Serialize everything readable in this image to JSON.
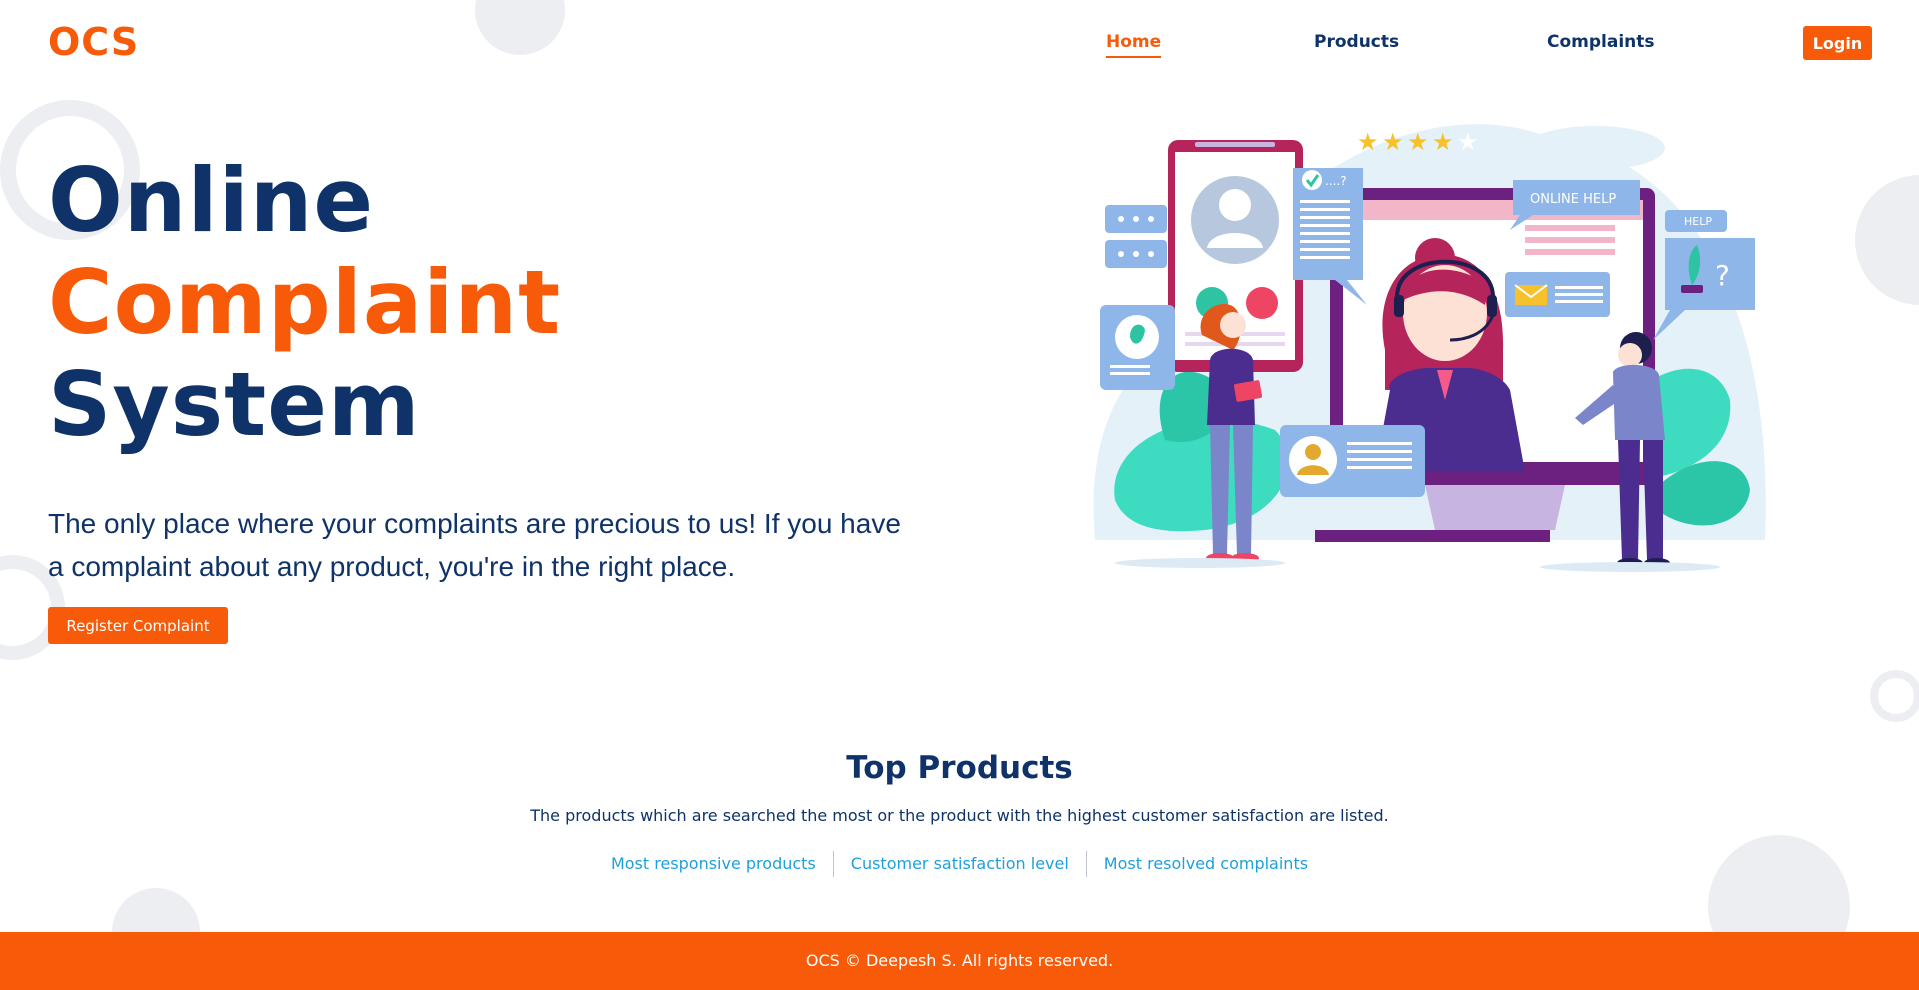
{
  "brand": {
    "logo": "OCS",
    "accent_color": "#f75a08",
    "navy_color": "#0f3369",
    "link_color": "#1ea0dc"
  },
  "nav": {
    "items": [
      {
        "label": "Home",
        "active": true
      },
      {
        "label": "Products",
        "active": false
      },
      {
        "label": "Complaints",
        "active": false
      }
    ],
    "login_label": "Login"
  },
  "hero": {
    "title_line1": "Online",
    "title_word_orange": "Complaint",
    "title_word_navy": "System",
    "description": "The only place where your complaints are precious to us! If you have a complaint about any product, you're in the right place.",
    "cta_label": "Register Complaint"
  },
  "illustration": {
    "online_help_label": "ONLINE HELP",
    "help_label": "HELP",
    "bubble_text": "....?",
    "rating_stars": 5,
    "filled_stars": 4
  },
  "products": {
    "heading": "Top Products",
    "subtitle": "The products which are searched the most or the product with the highest customer satisfaction are listed.",
    "tabs": [
      "Most responsive products",
      "Customer satisfaction level",
      "Most resolved complaints"
    ]
  },
  "footer": {
    "text": "OCS © Deepesh S. All rights reserved."
  }
}
